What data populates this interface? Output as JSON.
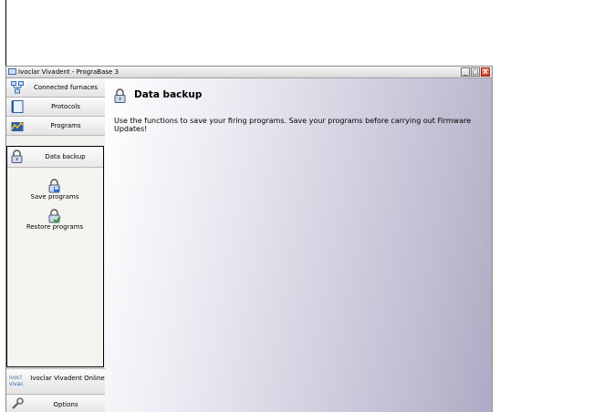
{
  "window": {
    "title": "Ivoclar Vivadent - PrograBase 3",
    "minimize_glyph": "_",
    "maximize_glyph": "□",
    "close_glyph": "X"
  },
  "sidebar": {
    "nav": [
      {
        "label": "Connected furnaces",
        "icon": "network-icon"
      },
      {
        "label": "Protocols",
        "icon": "notebook-icon"
      },
      {
        "label": "Programs",
        "icon": "program-chart-icon"
      }
    ],
    "panel": {
      "title": "Data backup",
      "icon": "padlock-icon",
      "actions": [
        {
          "label": "Save programs",
          "icon": "lock-save-icon"
        },
        {
          "label": "Restore programs",
          "icon": "lock-restore-icon"
        }
      ]
    },
    "online": {
      "label": "Ivoclar Vivadent Online",
      "logo_text": "ivocl vivac",
      "icon": "ivoclar-logo"
    },
    "options": {
      "label": "Options",
      "icon": "wrench-icon"
    }
  },
  "content": {
    "title": "Data backup",
    "icon": "padlock-icon",
    "description": "Use the functions to save your firing programs. Save your programs before carrying out Firmware Updates!"
  },
  "colors": {
    "accent": "#3a6db5",
    "content_gradient_end": "#adabc4"
  }
}
